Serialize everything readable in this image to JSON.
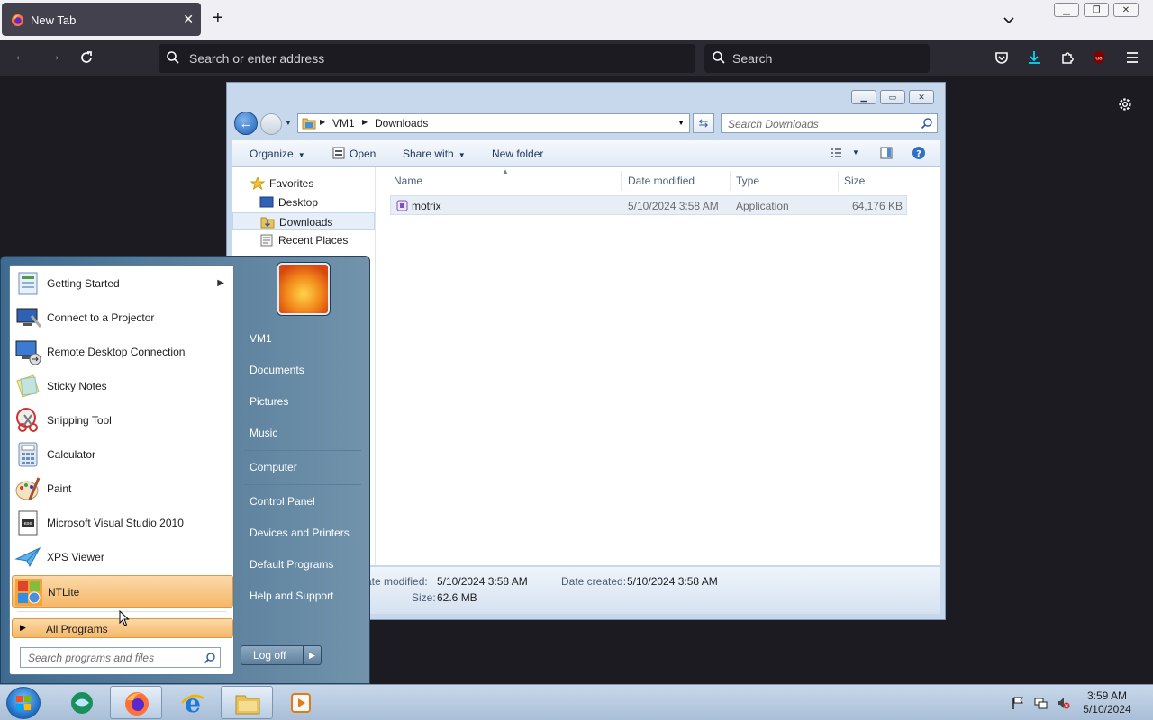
{
  "browser": {
    "tab_title": "New Tab",
    "address_placeholder": "Search or enter address",
    "search_placeholder": "Search"
  },
  "explorer": {
    "breadcrumb": [
      "VM1",
      "Downloads"
    ],
    "search_placeholder": "Search Downloads",
    "commands": {
      "organize": "Organize",
      "open": "Open",
      "share_with": "Share with",
      "new_folder": "New folder"
    },
    "nav": {
      "favorites": "Favorites",
      "items": [
        "Desktop",
        "Downloads",
        "Recent Places"
      ]
    },
    "columns": [
      "Name",
      "Date modified",
      "Type",
      "Size"
    ],
    "files": [
      {
        "name": "motrix",
        "date_modified": "5/10/2024 3:58 AM",
        "type": "Application",
        "size": "64,176 KB"
      }
    ],
    "details": {
      "date_modified_label": "ate modified:",
      "date_modified_value": "5/10/2024 3:58 AM",
      "date_created_label": "Date created:",
      "date_created_value": "5/10/2024 3:58 AM",
      "size_label": "Size:",
      "size_value": "62.6 MB"
    }
  },
  "start_menu": {
    "programs": [
      {
        "label": "Getting Started",
        "icon": "getting-started-icon"
      },
      {
        "label": "Connect to a Projector",
        "icon": "projector-icon"
      },
      {
        "label": "Remote Desktop Connection",
        "icon": "remote-desktop-icon"
      },
      {
        "label": "Sticky Notes",
        "icon": "sticky-notes-icon"
      },
      {
        "label": "Snipping Tool",
        "icon": "snipping-tool-icon"
      },
      {
        "label": "Calculator",
        "icon": "calculator-icon"
      },
      {
        "label": "Paint",
        "icon": "paint-icon"
      },
      {
        "label": "Microsoft Visual Studio 2010",
        "icon": "visual-studio-icon"
      },
      {
        "label": "XPS Viewer",
        "icon": "xps-viewer-icon"
      },
      {
        "label": "NTLite",
        "icon": "ntlite-icon"
      }
    ],
    "all_programs": "All Programs",
    "search_placeholder": "Search programs and files",
    "right_links": [
      "VM1",
      "Documents",
      "Pictures",
      "Music",
      "Computer",
      "Control Panel",
      "Devices and Printers",
      "Default Programs",
      "Help and Support"
    ],
    "log_off": "Log off"
  },
  "taskbar": {
    "time": "3:59 AM",
    "date": "5/10/2024"
  },
  "colors": {
    "firefox_toolbar": "#2b2a33",
    "start_menu_highlight": "#f5b869",
    "taskbar": "#b8cce2"
  }
}
